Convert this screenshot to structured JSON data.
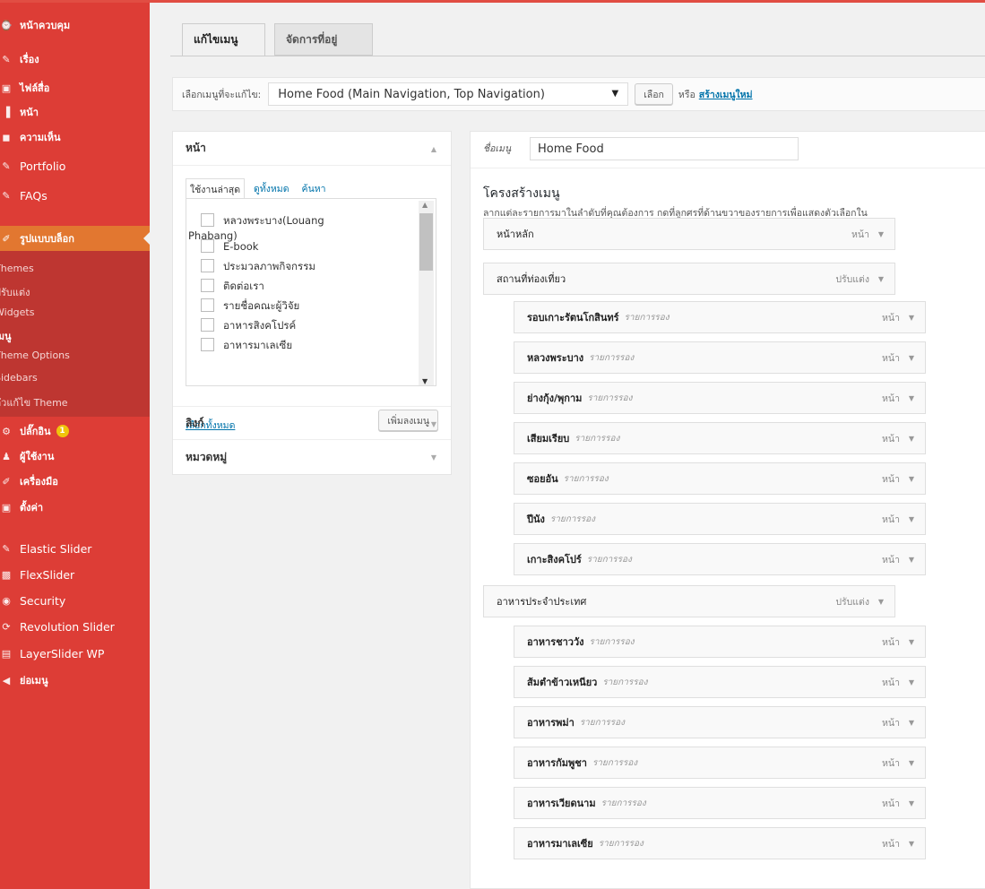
{
  "sidebar": {
    "items": [
      {
        "label": "หน้าควบคุม",
        "icon": "dashboard-icon",
        "glyph": "⌚"
      },
      {
        "label": "เรื่อง",
        "icon": "pin-icon",
        "glyph": "✎"
      },
      {
        "label": "ไฟล์สื่อ",
        "icon": "media-icon",
        "glyph": "▣"
      },
      {
        "label": "หน้า",
        "icon": "page-icon",
        "glyph": "▐"
      },
      {
        "label": "ความเห็น",
        "icon": "comment-icon",
        "glyph": "◼"
      },
      {
        "label": "Portfolio",
        "icon": "pin-icon",
        "glyph": "✎"
      },
      {
        "label": "FAQs",
        "icon": "pin-icon",
        "glyph": "✎"
      }
    ],
    "active": {
      "label": "รูปแบบบล็อก",
      "icon": "brush-icon",
      "glyph": "✐"
    },
    "submenu": [
      "Themes",
      "ปรับแต่ง",
      "Widgets",
      "เมนู",
      "Theme Options",
      "Sidebars",
      "ตัวแก้ไข Theme"
    ],
    "submenu_current": 3,
    "items2": [
      {
        "label": "ปลั๊กอิน",
        "icon": "plugin-icon",
        "glyph": "⚙",
        "badge": "1"
      },
      {
        "label": "ผู้ใช้งาน",
        "icon": "users-icon",
        "glyph": "♟"
      },
      {
        "label": "เครื่องมือ",
        "icon": "tools-icon",
        "glyph": "✐"
      },
      {
        "label": "ตั้งค่า",
        "icon": "settings-icon",
        "glyph": "▣"
      }
    ],
    "plugins": [
      {
        "label": "Elastic Slider",
        "icon": "pin-icon",
        "glyph": "✎"
      },
      {
        "label": "FlexSlider",
        "icon": "image-icon",
        "glyph": "▩"
      },
      {
        "label": "Security",
        "icon": "shield-icon",
        "glyph": "◉"
      },
      {
        "label": "Revolution Slider",
        "icon": "refresh-icon",
        "glyph": "⟳"
      },
      {
        "label": "LayerSlider WP",
        "icon": "layers-icon",
        "glyph": "▤"
      },
      {
        "label": "ย่อเมนู",
        "icon": "collapse-icon",
        "glyph": "◀"
      }
    ]
  },
  "tabs": {
    "edit": "แก้ไขเมนู",
    "locations": "จัดการที่อยู่"
  },
  "select_bar": {
    "label": "เลือกเมนูที่จะแก้ไข:",
    "selected": "Home Food (Main Navigation, Top Navigation)",
    "select_button": "เลือก",
    "or_text": "หรือ",
    "create_link": "สร้างเมนูใหม่"
  },
  "left": {
    "pages_title": "หน้า",
    "subtabs": [
      "ใช้งานล่าสุด",
      "ดูทั้งหมด",
      "ค้นหา"
    ],
    "pages": [
      "หลวงพระบาง(Louang",
      "E-book",
      "ประมวลภาพกิจกรรม",
      "ติดต่อเรา",
      "รายชื่อคณะผู้วิจัย",
      "อาหารสิงคโปรค์",
      "อาหารมาเลเซีย"
    ],
    "page0_wrap": "Phabang)",
    "select_all": "เลือกทั้งหมด",
    "add_button": "เพิ่มลงเมนู",
    "links_title": "ลิงก์",
    "categories_title": "หมวดหมู่"
  },
  "right": {
    "name_label": "ชื่อเมนู",
    "name_value": "Home Food",
    "structure_title": "โครงสร้างเมนู",
    "structure_desc": "ลากแต่ละรายการมาในลำดับที่คุณต้องการ กดที่ลูกศรที่ด้านขวาของรายการเพื่อแสดงตัวเลือกใน",
    "subitem_label": "รายการรอง",
    "items": [
      {
        "title": "หน้าหลัก",
        "type": "หน้า",
        "depth": 0
      },
      {
        "title": "สถานที่ท่องเที่ยว",
        "type": "ปรับแต่ง",
        "depth": 0
      },
      {
        "title": "รอบเกาะรัตนโกสินทร์",
        "type": "หน้า",
        "depth": 1
      },
      {
        "title": "หลวงพระบาง",
        "type": "หน้า",
        "depth": 1
      },
      {
        "title": "ย่างกุ้ง/พุกาม",
        "type": "หน้า",
        "depth": 1
      },
      {
        "title": "เสียมเรียบ",
        "type": "หน้า",
        "depth": 1
      },
      {
        "title": "ซอยอัน",
        "type": "หน้า",
        "depth": 1
      },
      {
        "title": "ปีนัง",
        "type": "หน้า",
        "depth": 1
      },
      {
        "title": "เกาะสิงคโปร์",
        "type": "หน้า",
        "depth": 1
      },
      {
        "title": "อาหารประจำประเทศ",
        "type": "ปรับแต่ง",
        "depth": 0
      },
      {
        "title": "อาหารชาววัง",
        "type": "หน้า",
        "depth": 1
      },
      {
        "title": "ส้มตำข้าวเหนียว",
        "type": "หน้า",
        "depth": 1
      },
      {
        "title": "อาหารพม่า",
        "type": "หน้า",
        "depth": 1
      },
      {
        "title": "อาหารกัมพูชา",
        "type": "หน้า",
        "depth": 1
      },
      {
        "title": "อาหารเวียดนาม",
        "type": "หน้า",
        "depth": 1
      },
      {
        "title": "อาหารมาเลเซีย",
        "type": "หน้า",
        "depth": 1
      }
    ]
  }
}
